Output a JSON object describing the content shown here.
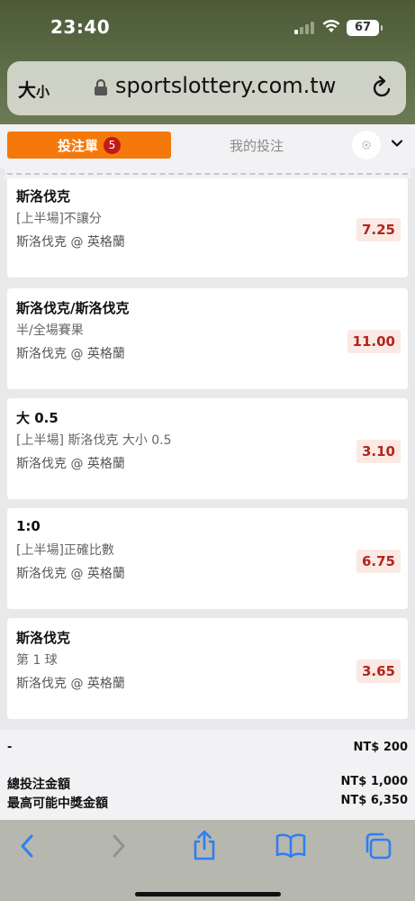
{
  "status": {
    "time": "23:40",
    "battery": "67"
  },
  "browser": {
    "text_size_label": "大",
    "text_size_small": "小",
    "url": "sportslottery.com.tw"
  },
  "tabs": {
    "active_label": "投注單",
    "active_count": "5",
    "inactive_label": "我的投注"
  },
  "bets": [
    {
      "selection": "斯洛伐克",
      "market": "[上半場]不讓分",
      "match": "斯洛伐克 @ 英格蘭",
      "odds": "7.25"
    },
    {
      "selection": "斯洛伐克/斯洛伐克",
      "market": "半/全場賽果",
      "match": "斯洛伐克 @ 英格蘭",
      "odds": "11.00"
    },
    {
      "selection": "大 0.5",
      "market": "[上半場] 斯洛伐克 大小 0.5",
      "match": "斯洛伐克 @ 英格蘭",
      "odds": "3.10"
    },
    {
      "selection": "1:0",
      "market": "[上半場]正確比數",
      "match": "斯洛伐克 @ 英格蘭",
      "odds": "6.75"
    },
    {
      "selection": "斯洛伐克",
      "market": "第 1 球",
      "match": "斯洛伐克 @ 英格蘭",
      "odds": "3.65"
    }
  ],
  "summary": {
    "stake_label": "-",
    "stake_value": "NT$ 200",
    "total_label": "總投注金額",
    "total_value": "NT$ 1,000",
    "max_payout_label": "最高可能中獎金額",
    "max_payout_value": "NT$ 6,350"
  },
  "colors": {
    "accent": "#f5780a",
    "badge": "#c01a1a",
    "odds_text": "#b3261e",
    "toolbar_icon": "#2f7ef5"
  }
}
